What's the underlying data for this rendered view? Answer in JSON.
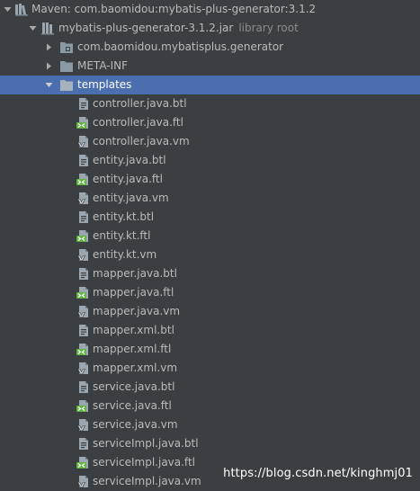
{
  "tree": {
    "maven_lib": {
      "label": "Maven: com.baomidou:mybatis-plus-generator:3.1.2",
      "icon": "library-icon",
      "expanded": true
    },
    "jar": {
      "label": "mybatis-plus-generator-3.1.2.jar",
      "secondary": "library root",
      "icon": "jar-icon",
      "expanded": true
    },
    "package": {
      "label": "com.baomidou.mybatisplus.generator",
      "icon": "package-icon",
      "expanded": false
    },
    "meta_inf": {
      "label": "META-INF",
      "icon": "folder-icon",
      "expanded": false
    },
    "templates": {
      "label": "templates",
      "icon": "folder-icon",
      "expanded": true,
      "selected": true
    },
    "files": [
      {
        "name": "controller.java.btl",
        "type": "btl"
      },
      {
        "name": "controller.java.ftl",
        "type": "ftl"
      },
      {
        "name": "controller.java.vm",
        "type": "vm"
      },
      {
        "name": "entity.java.btl",
        "type": "btl"
      },
      {
        "name": "entity.java.ftl",
        "type": "ftl"
      },
      {
        "name": "entity.java.vm",
        "type": "vm"
      },
      {
        "name": "entity.kt.btl",
        "type": "btl"
      },
      {
        "name": "entity.kt.ftl",
        "type": "ftl"
      },
      {
        "name": "entity.kt.vm",
        "type": "vm"
      },
      {
        "name": "mapper.java.btl",
        "type": "btl"
      },
      {
        "name": "mapper.java.ftl",
        "type": "ftl"
      },
      {
        "name": "mapper.java.vm",
        "type": "vm"
      },
      {
        "name": "mapper.xml.btl",
        "type": "btl"
      },
      {
        "name": "mapper.xml.ftl",
        "type": "ftl"
      },
      {
        "name": "mapper.xml.vm",
        "type": "vm"
      },
      {
        "name": "service.java.btl",
        "type": "btl"
      },
      {
        "name": "service.java.ftl",
        "type": "ftl"
      },
      {
        "name": "service.java.vm",
        "type": "vm"
      },
      {
        "name": "serviceImpl.java.btl",
        "type": "btl"
      },
      {
        "name": "serviceImpl.java.ftl",
        "type": "ftl"
      },
      {
        "name": "serviceImpl.java.vm",
        "type": "vm"
      }
    ]
  },
  "watermark": "https://blog.csdn.net/kinghmj01",
  "colors": {
    "background": "#3c3f41",
    "selection": "#4b6eaf",
    "text": "#bbbbbb",
    "secondary_text": "#8c8c8c",
    "ftl_badge": "#62b543"
  }
}
